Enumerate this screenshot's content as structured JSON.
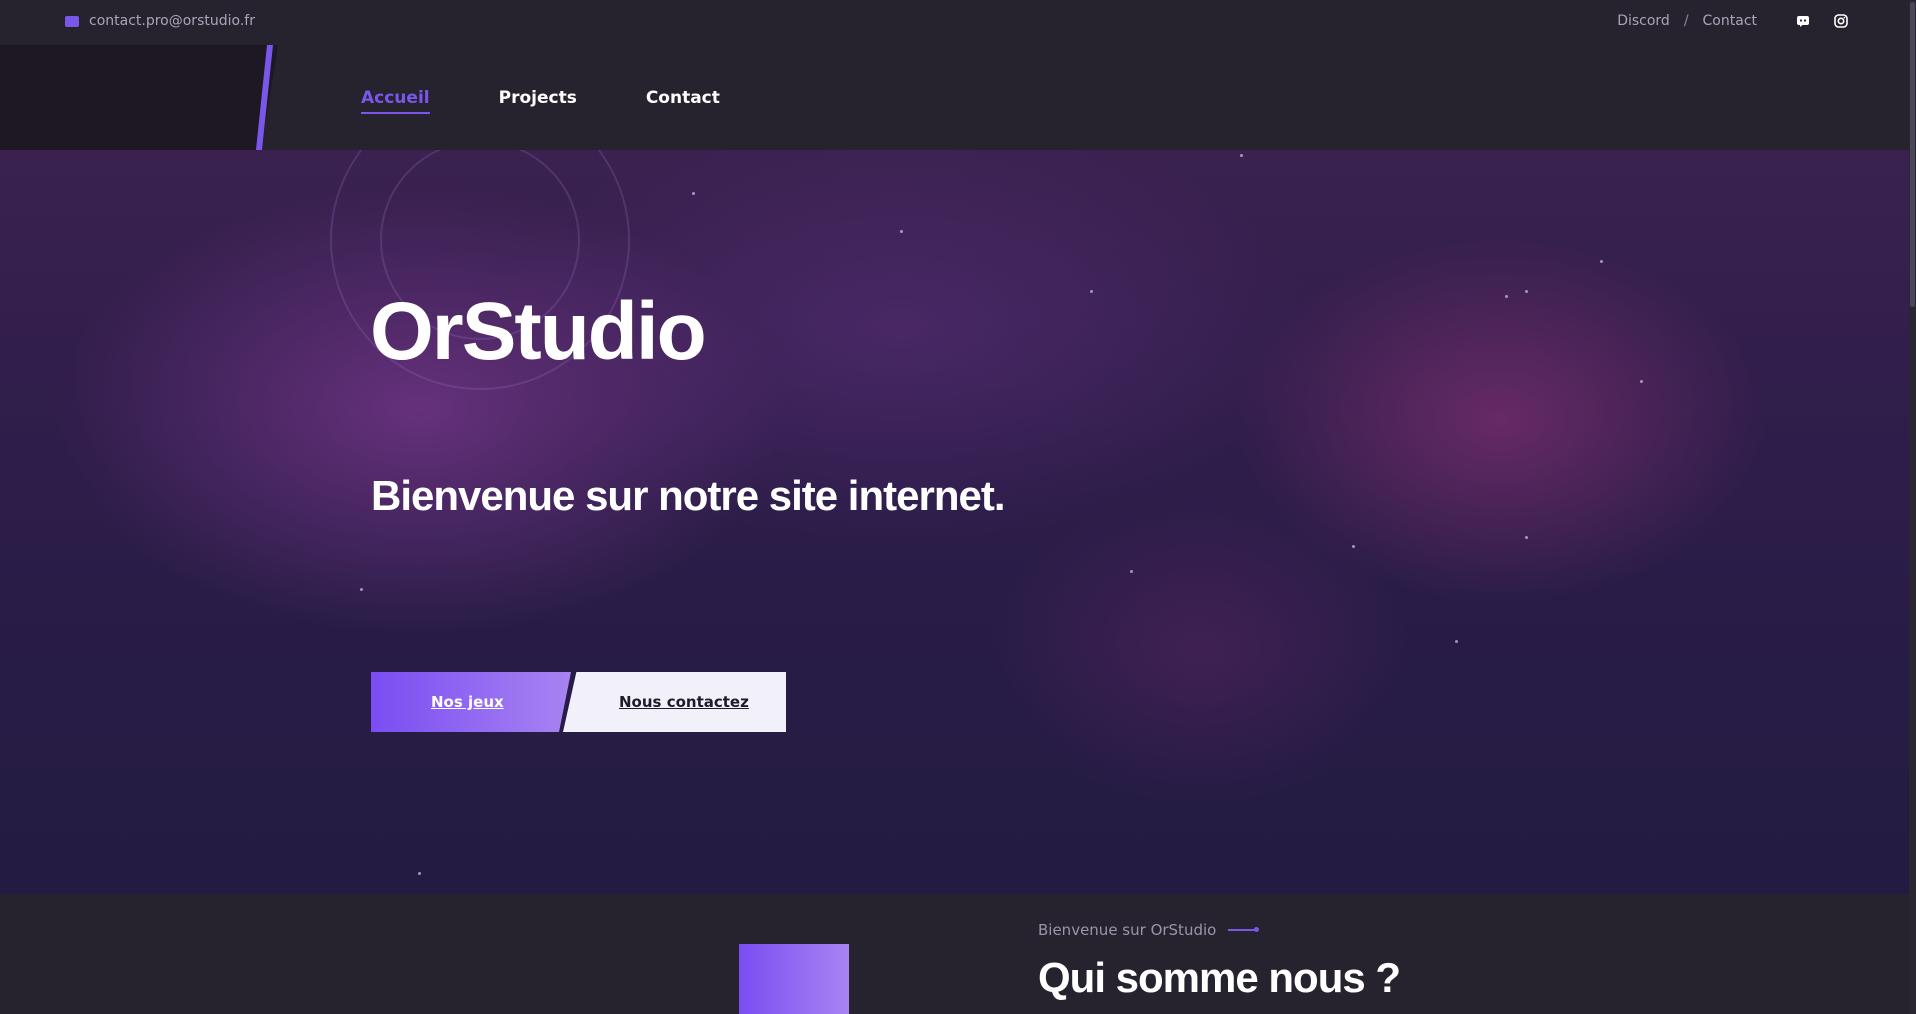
{
  "topbar": {
    "email": "contact.pro@orstudio.fr",
    "links": [
      {
        "label": "Discord"
      },
      {
        "label": "Contact"
      }
    ],
    "separator": "/",
    "social_icons": [
      "discord-icon",
      "instagram-icon"
    ]
  },
  "nav": {
    "items": [
      {
        "label": "Accueil",
        "active": true
      },
      {
        "label": "Projects",
        "active": false
      },
      {
        "label": "Contact",
        "active": false
      }
    ]
  },
  "hero": {
    "title": "OrStudio",
    "subtitle": "Bienvenue sur notre site internet.",
    "primary_button": "Nos jeux",
    "secondary_button": "Nous contactez"
  },
  "about": {
    "kicker": "Bienvenue sur OrStudio",
    "heading": "Qui somme nous ?"
  },
  "colors": {
    "accent": "#7a57ea",
    "topbar_bg": "#26232f",
    "hero_bg": "#2e1d4a"
  }
}
